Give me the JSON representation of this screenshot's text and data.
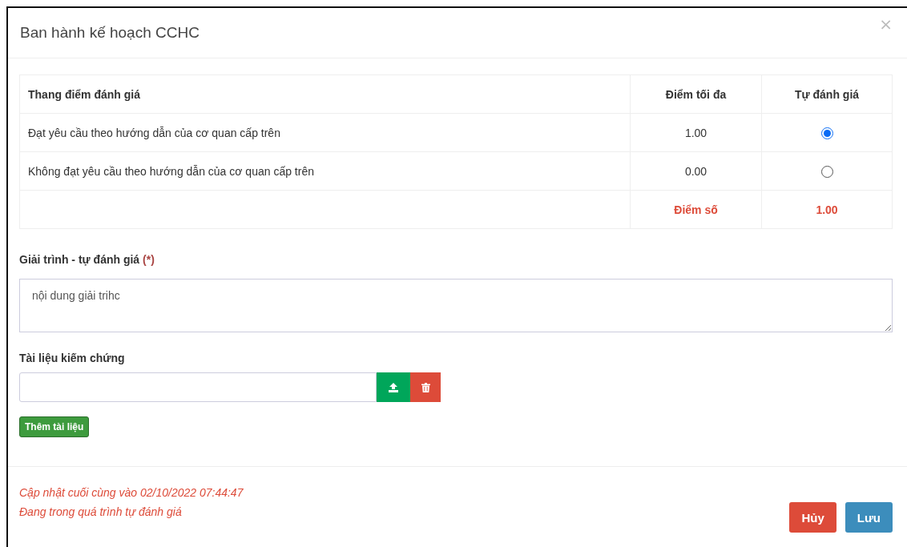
{
  "dialog": {
    "title": "Ban hành kế hoạch CCHC",
    "close": "×"
  },
  "table": {
    "columns": [
      "Thang điểm đánh giá",
      "Điểm tối đa",
      "Tự đánh giá"
    ],
    "rows": [
      {
        "criterion": "Đạt yêu cầu theo hướng dẫn của cơ quan cấp trên",
        "max": "1.00",
        "selected": true
      },
      {
        "criterion": "Không đạt yêu cầu theo hướng dẫn của cơ quan cấp trên",
        "max": "0.00",
        "selected": false
      }
    ],
    "total": {
      "label": "Điểm số",
      "value": "1.00"
    }
  },
  "explanation": {
    "label": "Giải trình - tự đánh giá",
    "required_mark": "(*)",
    "value": "nội dung giải trihc"
  },
  "evidence": {
    "label": "Tài liệu kiếm chứng",
    "add_button": "Thêm tài liệu"
  },
  "footer": {
    "notes": [
      "Cập nhật cuối cùng vào 02/10/2022 07:44:47",
      "Đang trong quá trình tự đánh giá"
    ],
    "buttons": [
      {
        "label": "Hủy",
        "kind": "cancel"
      },
      {
        "label": "Lưu",
        "kind": "save"
      }
    ]
  }
}
